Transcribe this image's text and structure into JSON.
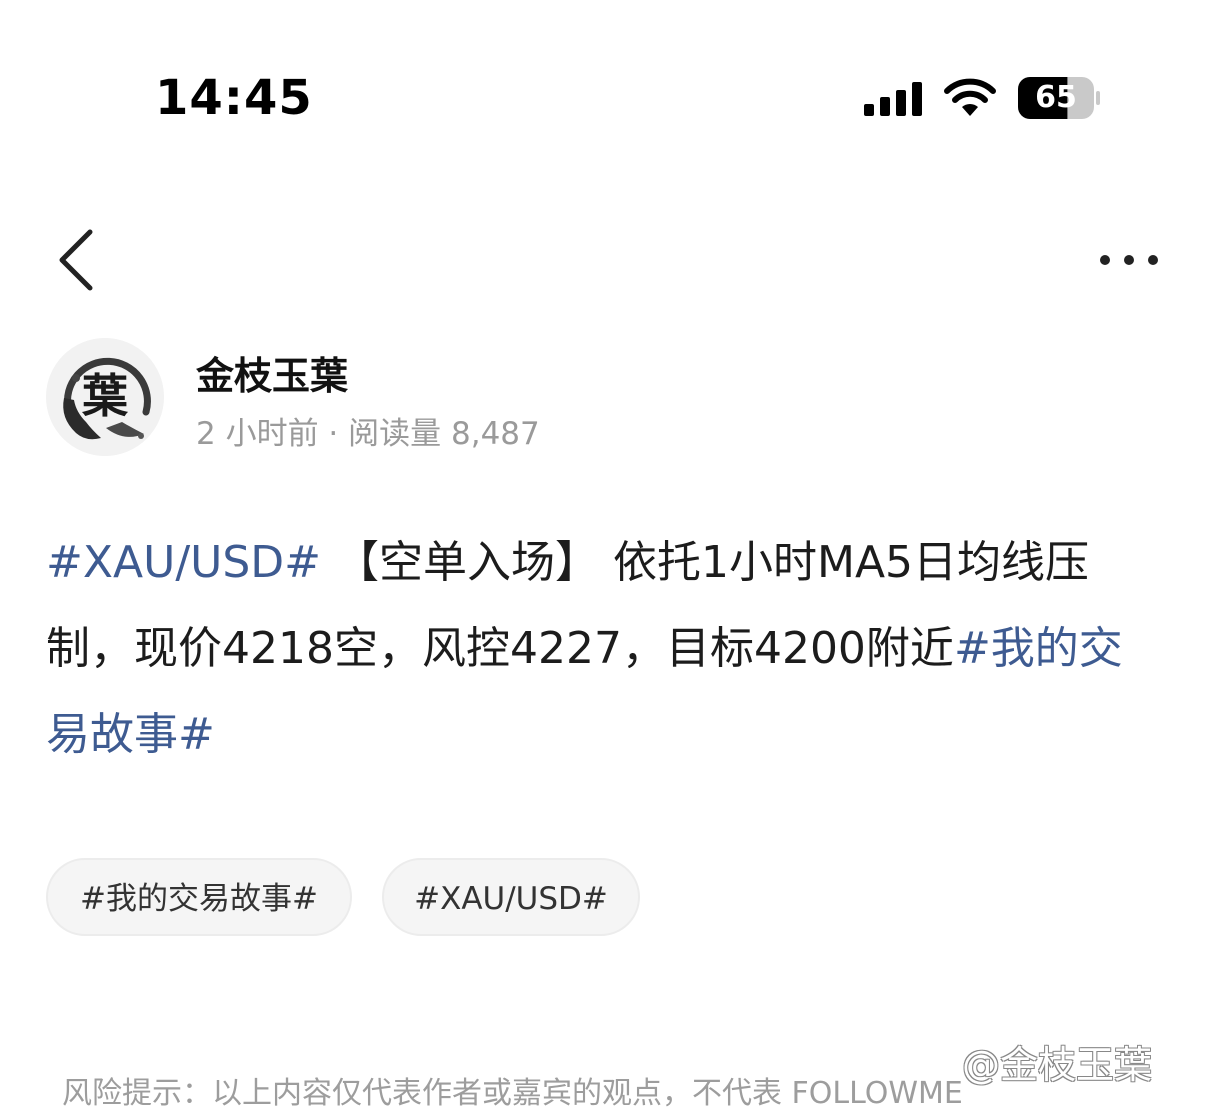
{
  "status_bar": {
    "time": "14:45",
    "battery_level": "65",
    "icons": [
      "cellular-signal-icon",
      "wifi-icon",
      "battery-icon"
    ]
  },
  "nav": {
    "back_icon": "chevron-left-icon",
    "more_icon": "more-horizontal-icon"
  },
  "author": {
    "name": "金枝玉葉",
    "avatar_char": "葉",
    "meta": "2 小时前 · 阅读量 8,487"
  },
  "post": {
    "hashtag_start": "#XAU/USD#",
    "body": " 【空单入场】 依托1小时MA5日均线压制，现价4218空，风控4227，目标4200附近",
    "hashtag_end": "#我的交易故事#"
  },
  "tags": [
    {
      "label": "#我的交易故事#"
    },
    {
      "label": "#XAU/USD#"
    }
  ],
  "footer": {
    "risk_text": "风险提示：以上内容仅代表作者或嘉宾的观点，不代表 FOLLOWME",
    "watermark": "@金枝玉葉"
  },
  "colors": {
    "hashtag": "#3e5b91",
    "meta_gray": "#9a9a9a",
    "tag_bg": "#f5f5f5"
  }
}
